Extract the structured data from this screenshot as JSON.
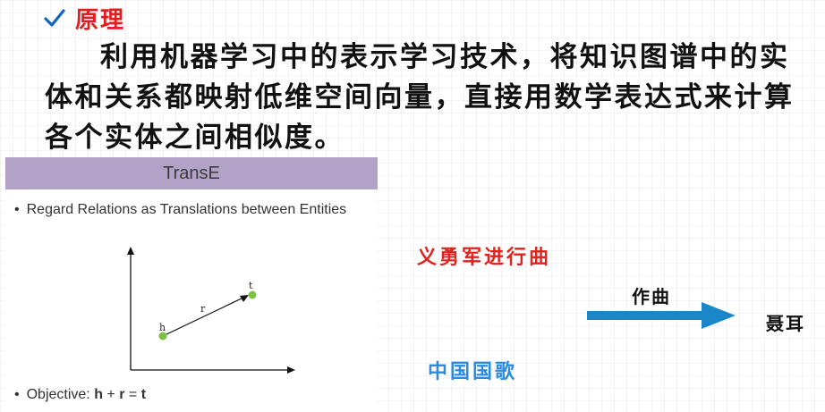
{
  "heading": {
    "text": "原理",
    "check_color": "#1565c0",
    "color": "#e01e1e"
  },
  "body": {
    "text": "利用机器学习中的表示学习技术，将知识图谱中的实体和关系都映射低维空间向量，直接用数学表达式来计算各个实体之间相似度。"
  },
  "transe": {
    "title": "TransE",
    "title_bar_color": "#b3a2c7",
    "bullet1": "Regard Relations as Translations between Entities",
    "bullet2_prefix": "Objective: ",
    "bullet2_h": "h",
    "bullet2_plus": " + ",
    "bullet2_r": "r",
    "bullet2_eq": " = ",
    "bullet2_t": "t",
    "diagram": {
      "head_label": "h",
      "relation_label": "r",
      "tail_label": "t",
      "point_color": "#7dc242"
    }
  },
  "example": {
    "song": "义勇军进行曲",
    "song_color": "#e0231c",
    "anthem": "中国国歌",
    "anthem_color": "#2a8be0",
    "relation": "作曲",
    "arrow_color": "#1b87c9",
    "person": "聂耳"
  }
}
